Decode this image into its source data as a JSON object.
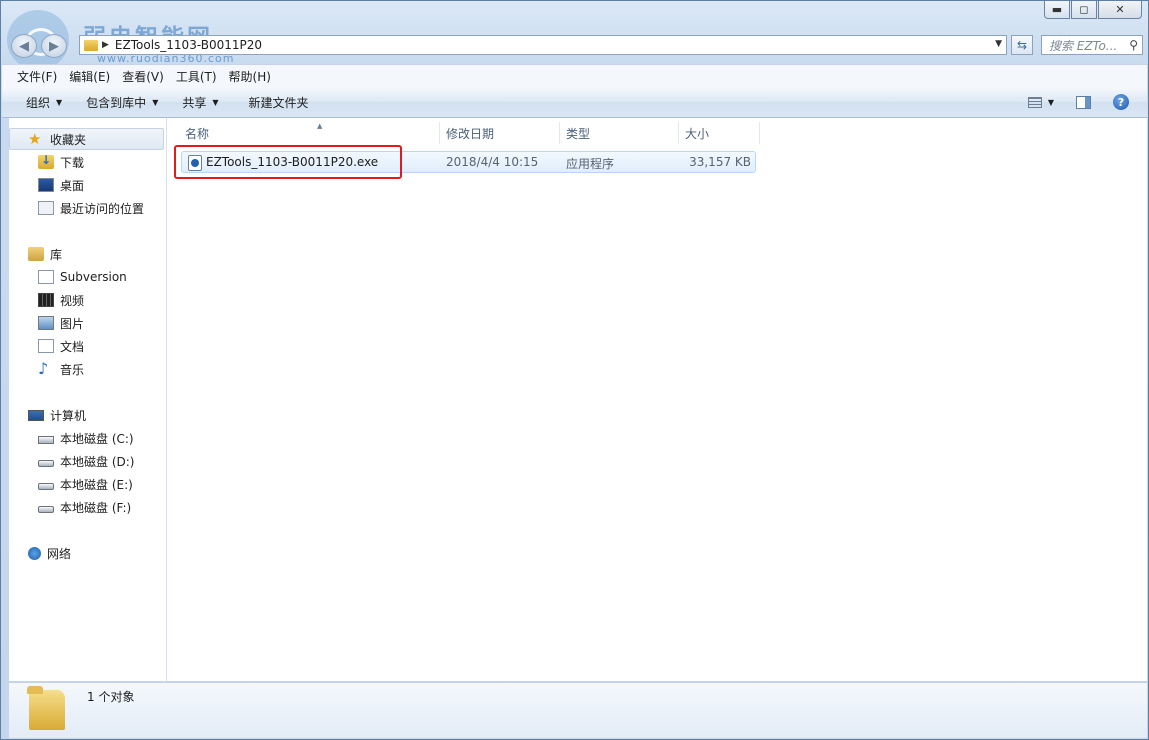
{
  "watermark": {
    "brand": "弱电智能网",
    "url": "www.ruodian360.com"
  },
  "window": {
    "caption_buttons": {
      "minimize": "▬",
      "maximize": "◻",
      "close": "✕"
    }
  },
  "nav": {
    "back_icon": "back-arrow-icon",
    "forward_icon": "forward-arrow-icon",
    "address_path": "EZTools_1103-B0011P20",
    "search_placeholder": "搜索 EZTo..."
  },
  "menu": [
    "文件(F)",
    "编辑(E)",
    "查看(V)",
    "工具(T)",
    "帮助(H)"
  ],
  "toolbar": {
    "organize": "组织",
    "include_library": "包含到库中",
    "share": "共享",
    "new_folder": "新建文件夹",
    "help": "?"
  },
  "sidebar": {
    "favorites": {
      "label": "收藏夹",
      "items": [
        "下载",
        "桌面",
        "最近访问的位置"
      ]
    },
    "libraries": {
      "label": "库",
      "items": [
        "Subversion",
        "视频",
        "图片",
        "文档",
        "音乐"
      ]
    },
    "computer": {
      "label": "计算机",
      "items": [
        "本地磁盘 (C:)",
        "本地磁盘 (D:)",
        "本地磁盘 (E:)",
        "本地磁盘 (F:)"
      ]
    },
    "network": {
      "label": "网络"
    }
  },
  "columns": [
    "名称",
    "修改日期",
    "类型",
    "大小"
  ],
  "files": [
    {
      "name": "EZTools_1103-B0011P20.exe",
      "modified": "2018/4/4 10:15",
      "type": "应用程序",
      "size": "33,157 KB"
    }
  ],
  "status": {
    "count_text": "1 个对象"
  },
  "colors": {
    "highlight_box": "#e11b1b",
    "selection": "#e0eefc",
    "accent": "#1c58b0"
  }
}
